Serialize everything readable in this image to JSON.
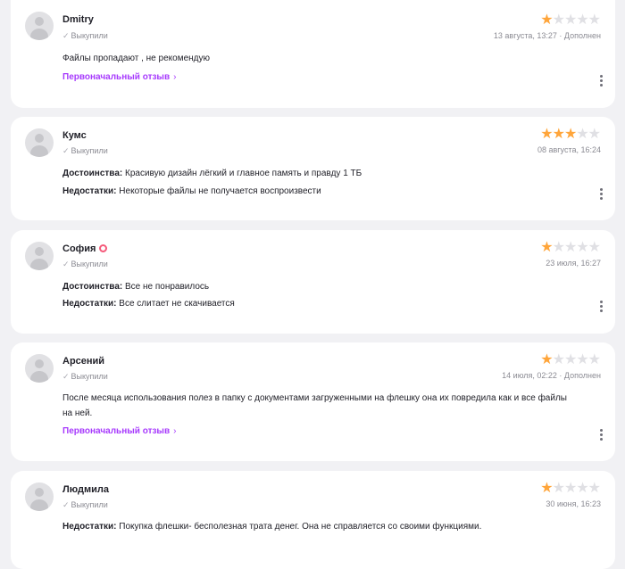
{
  "reviews": [
    {
      "name": "Dmitry",
      "bought": "Выкупили",
      "rating": 1,
      "date": "13 августа, 13:27 · Дополнен",
      "text": "Файлы пропадают , не рекомендую",
      "original_link": "Первоначальный отзыв"
    },
    {
      "name": "Кумс",
      "bought": "Выкупили",
      "rating": 3,
      "date": "08 августа, 16:24",
      "pros_label": "Достоинства:",
      "pros": "Красивую дизайн лёгкий и главное память и правду 1 ТБ",
      "cons_label": "Недостатки:",
      "cons": "Некоторые файлы не получается воспроизвести"
    },
    {
      "name": "София",
      "bought": "Выкупили",
      "rating": 1,
      "date": "23 июля, 16:27",
      "pros_label": "Достоинства:",
      "pros": "Все не понравилось",
      "cons_label": "Недостатки:",
      "cons": "Все слитает не скачивается"
    },
    {
      "name": "Арсений",
      "bought": "Выкупили",
      "rating": 1,
      "date": "14 июля, 02:22 · Дополнен",
      "text": "После месяца использования полез в папку с документами загруженными на флешку она их повредила как и все файлы на ней.",
      "original_link": "Первоначальный отзыв"
    },
    {
      "name": "Людмила",
      "bought": "Выкупили",
      "rating": 1,
      "date": "30 июня, 16:23",
      "cons_label": "Недостатки:",
      "cons": "Покупка флешки- бесполезная трата денег. Она не справляется со своими функциями."
    }
  ],
  "colors": {
    "star_on": "#ffa53a",
    "star_off": "#e0e0e4",
    "link": "#a73afd",
    "background": "#f1f1f4"
  },
  "icons": {
    "star": "star-icon",
    "check": "check-icon",
    "chevron": "chevron-right-icon",
    "more": "more-vertical-icon",
    "avatar": "user-avatar-icon"
  }
}
